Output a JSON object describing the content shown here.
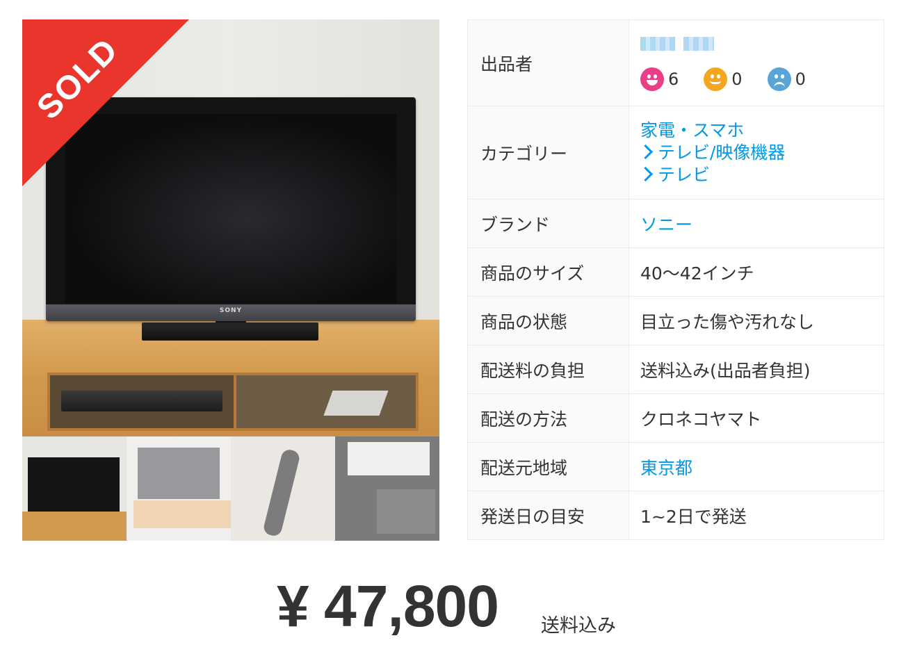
{
  "item": {
    "sold_badge": "SOLD",
    "main_photo": {
      "brand_on_tv": "SONY"
    },
    "thumbnails": [
      "thumbnail-tv-front",
      "thumbnail-tv-angle",
      "thumbnail-remote",
      "thumbnail-back-label"
    ]
  },
  "details": {
    "seller": {
      "label": "出品者",
      "name_blurred": true,
      "ratings": {
        "good": "6",
        "normal": "0",
        "bad": "0"
      }
    },
    "category": {
      "label": "カテゴリー",
      "levels": [
        "家電・スマホ",
        "テレビ/映像機器",
        "テレビ"
      ]
    },
    "brand": {
      "label": "ブランド",
      "value": "ソニー"
    },
    "size": {
      "label": "商品のサイズ",
      "value": "40〜42インチ"
    },
    "condition": {
      "label": "商品の状態",
      "value": "目立った傷や汚れなし"
    },
    "shipping_fee": {
      "label": "配送料の負担",
      "value": "送料込み(出品者負担)"
    },
    "shipping_method": {
      "label": "配送の方法",
      "value": "クロネコヤマト"
    },
    "ship_from": {
      "label": "配送元地域",
      "value": "東京都"
    },
    "ship_days": {
      "label": "発送日の目安",
      "value": "1~2日で発送"
    }
  },
  "price": {
    "amount": "¥ 47,800",
    "note": "送料込み"
  },
  "colors": {
    "link": "#0099e8",
    "sold": "#ea352d",
    "good": "#ea3e88",
    "normal": "#f4a71e",
    "bad": "#5aa5d8"
  }
}
